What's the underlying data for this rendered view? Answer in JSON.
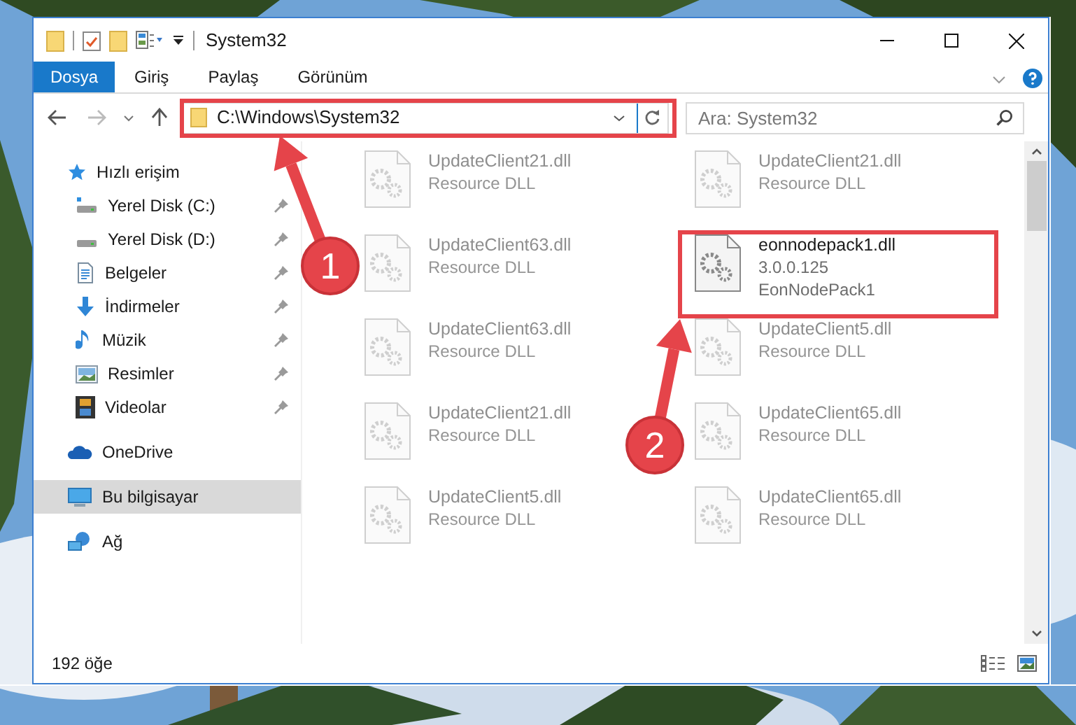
{
  "window": {
    "title": "System32"
  },
  "ribbon_tabs": [
    {
      "label": "Dosya",
      "selected": true
    },
    {
      "label": "Giriş",
      "selected": false
    },
    {
      "label": "Paylaş",
      "selected": false
    },
    {
      "label": "Görünüm",
      "selected": false
    }
  ],
  "address": {
    "path": "C:\\Windows\\System32"
  },
  "search": {
    "placeholder": "Ara: System32"
  },
  "sidebar": {
    "items": [
      {
        "label": "Hızlı erişim",
        "kind": "star",
        "selected": false,
        "children": [
          {
            "label": "Yerel Disk (C:)",
            "kind": "system-drive",
            "selected": false,
            "pinned": true
          },
          {
            "label": "Yerel Disk (D:)",
            "kind": "drive",
            "selected": false,
            "pinned": true
          },
          {
            "label": "Belgeler",
            "kind": "documents",
            "selected": false,
            "pinned": true
          },
          {
            "label": "İndirmeler",
            "kind": "downloads",
            "selected": false,
            "pinned": true
          },
          {
            "label": "Müzik",
            "kind": "music",
            "selected": false,
            "pinned": true
          },
          {
            "label": "Resimler",
            "kind": "pictures",
            "selected": false,
            "pinned": true
          },
          {
            "label": "Videolar",
            "kind": "videos",
            "selected": false,
            "pinned": true
          }
        ]
      },
      {
        "label": "OneDrive",
        "kind": "cloud",
        "selected": false
      },
      {
        "label": "Bu bilgisayar",
        "kind": "computer",
        "selected": true
      },
      {
        "label": "Ağ",
        "kind": "network",
        "selected": false
      }
    ]
  },
  "files": [
    {
      "name": "UpdateClient21.dll",
      "lines": [
        "Resource DLL"
      ],
      "faded": true
    },
    {
      "name": "UpdateClient21.dll",
      "lines": [
        "Resource DLL"
      ],
      "faded": true
    },
    {
      "name": "UpdateClient63.dll",
      "lines": [
        "Resource DLL"
      ],
      "faded": true
    },
    {
      "name": "eonnodepack1.dll",
      "lines": [
        "3.0.0.125",
        "EonNodePack1"
      ],
      "faded": false
    },
    {
      "name": "UpdateClient63.dll",
      "lines": [
        "Resource DLL"
      ],
      "faded": true
    },
    {
      "name": "UpdateClient5.dll",
      "lines": [
        "Resource DLL"
      ],
      "faded": true
    },
    {
      "name": "UpdateClient21.dll",
      "lines": [
        "Resource DLL"
      ],
      "faded": true
    },
    {
      "name": "UpdateClient65.dll",
      "lines": [
        "Resource DLL"
      ],
      "faded": true
    },
    {
      "name": "UpdateClient5.dll",
      "lines": [
        "Resource DLL"
      ],
      "faded": true
    },
    {
      "name": "UpdateClient65.dll",
      "lines": [
        "Resource DLL"
      ],
      "faded": true
    }
  ],
  "status_bar": {
    "count": "192 öğe"
  },
  "callouts": [
    {
      "number": "1"
    },
    {
      "number": "2"
    }
  ]
}
